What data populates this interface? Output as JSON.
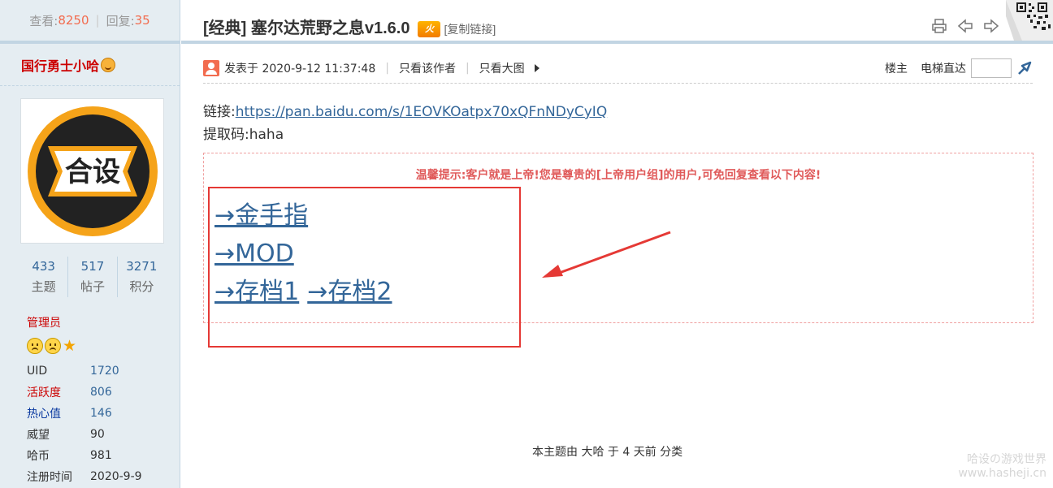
{
  "sidebar": {
    "stats": {
      "views_label": "查看:",
      "views": "8250",
      "replies_label": "回复:",
      "replies": "35"
    },
    "author_name": "国行勇士小哈",
    "counts": [
      {
        "value": "433",
        "label": "主题"
      },
      {
        "value": "517",
        "label": "帖子"
      },
      {
        "value": "3271",
        "label": "积分"
      }
    ],
    "role": "管理员",
    "info": [
      {
        "key": "UID",
        "value": "1720"
      },
      {
        "key": "活跃度",
        "value": "806"
      },
      {
        "key": "热心值",
        "value": "146"
      },
      {
        "key": "威望",
        "value": "90"
      },
      {
        "key": "哈币",
        "value": "981"
      },
      {
        "key": "注册时间",
        "value": "2020-9-9"
      }
    ]
  },
  "post": {
    "title": "[经典] 塞尔达荒野之息v1.6.0",
    "hot_badge": "火",
    "copy_link": "[复制链接]",
    "posted_at": "发表于 2020-9-12 11:37:48",
    "only_author": "只看该作者",
    "only_big_image": "只看大图",
    "floor": "楼主",
    "jump_label": "电梯直达",
    "link_label": "链接:",
    "link_url": "https://pan.baidu.com/s/1EOVKOatpx70xQFnNDyCyIQ",
    "code_label": "提取码:",
    "code_value": "haha",
    "notice": "温馨提示:客户就是上帝!您是尊贵的[上帝用户组]的用户,可免回复查看以下内容!",
    "links": {
      "cheat": "→金手指",
      "mod": "→MOD",
      "save1": "→存档1",
      "save2": "→存档2"
    },
    "footer": "本主题由 大哈 于 4 天前 分类"
  },
  "watermark": {
    "line1": "哈设の游戏世界",
    "line2": "www.hasheji.cn"
  },
  "icons": [
    "print-icon",
    "prev-thread-icon",
    "next-thread-icon",
    "qr-code-icon",
    "user-icon",
    "jump-go-icon",
    "medal-icon",
    "star-icon"
  ],
  "colors": {
    "accent_red": "#c00",
    "link_blue": "#336699",
    "sidebar_bg": "#e5edf2",
    "annotation_red": "#e53935"
  }
}
